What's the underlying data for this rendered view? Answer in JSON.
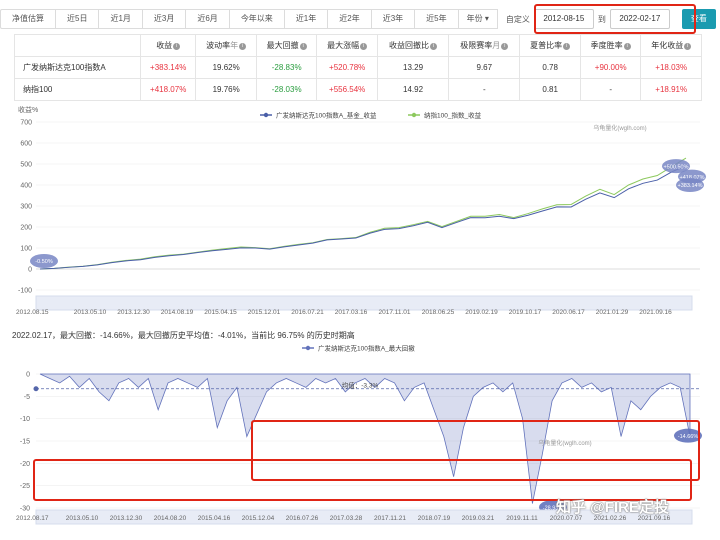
{
  "tabs": [
    "净值估算",
    "近5日",
    "近1月",
    "近3月",
    "近6月",
    "今年以来",
    "近1年",
    "近2年",
    "近3年",
    "近5年"
  ],
  "year_select": "年份",
  "custom_label": "自定义",
  "start_date": "2012-08-15",
  "to_label": "到",
  "end_date": "2022-02-17",
  "query_button": "查看",
  "stats": {
    "headers": [
      "收益",
      "波动率",
      "最大回撤",
      "最大涨幅",
      "收益回撤比",
      "极限赛率",
      "夏普比率",
      "季度胜率",
      "年化收益"
    ],
    "header_units": [
      "",
      "年",
      "",
      "",
      "",
      "月",
      "",
      "",
      ""
    ],
    "header_info": [
      true,
      true,
      true,
      true,
      true,
      true,
      true,
      true,
      true
    ],
    "rows": [
      {
        "name": "广发纳斯达克100指数A",
        "values": [
          "+383.14%",
          "19.62%",
          "-28.83%",
          "+520.78%",
          "13.29",
          "9.67",
          "0.78",
          "+90.00%",
          "+18.03%"
        ],
        "tones": [
          "pos",
          "",
          "neg",
          "pos",
          "",
          "",
          "",
          "pos",
          "pos"
        ]
      },
      {
        "name": "纳指100",
        "values": [
          "+418.07%",
          "19.76%",
          "-28.03%",
          "+556.54%",
          "14.92",
          "-",
          "0.81",
          "-",
          "+18.91%"
        ],
        "tones": [
          "pos",
          "",
          "neg",
          "pos",
          "",
          "",
          "",
          "",
          "pos"
        ]
      }
    ]
  },
  "chart_data": [
    {
      "type": "line",
      "ylabel": "收益%",
      "ylim": [
        -100,
        700
      ],
      "yticks": [
        -100,
        0,
        100,
        200,
        300,
        400,
        500,
        600,
        700
      ],
      "x_start_label": "2012.08.15",
      "xticks": [
        "2013.05.10",
        "2013.12.30",
        "2014.08.19",
        "2015.04.15",
        "2015.12.01",
        "2016.07.21",
        "2017.03.16",
        "2017.11.01",
        "2018.06.25",
        "2019.02.19",
        "2019.10.17",
        "2020.06.17",
        "2021.01.29",
        "2021.09.16"
      ],
      "series": [
        {
          "name": "广发纳斯达克100指数A_基金_收益",
          "color": "#4a5fa8",
          "values": [
            0,
            3,
            8,
            12,
            20,
            30,
            38,
            45,
            55,
            62,
            70,
            78,
            85,
            95,
            100,
            98,
            96,
            105,
            112,
            125,
            138,
            140,
            150,
            170,
            185,
            195,
            205,
            218,
            200,
            220,
            240,
            248,
            250,
            235,
            260,
            275,
            290,
            300,
            330,
            355,
            345,
            380,
            400,
            430,
            460,
            483
          ]
        },
        {
          "name": "纳指100_指数_收益",
          "color": "#8dc95e",
          "values": [
            0,
            3,
            9,
            13,
            21,
            32,
            40,
            48,
            58,
            65,
            72,
            80,
            88,
            99,
            104,
            100,
            98,
            107,
            115,
            127,
            140,
            142,
            152,
            174,
            190,
            200,
            210,
            222,
            205,
            225,
            246,
            255,
            258,
            240,
            268,
            285,
            300,
            312,
            345,
            372,
            360,
            398,
            420,
            452,
            485,
            518
          ]
        }
      ],
      "markers": [
        {
          "label": "-0.50%",
          "color": "#7886c4"
        },
        {
          "label": "+500.50%",
          "color": "#7886c4"
        },
        {
          "label": "+418.07%",
          "color": "#7886c4"
        },
        {
          "label": "+383.14%",
          "color": "#7886c4"
        }
      ],
      "annotation": "乌龟量化(wglh.com)"
    },
    {
      "type": "area",
      "summary": "2022.02.17，最大回撤：-14.66%，最大回撤历史平均值：-4.01%，当前比 96.75% 的历史时期高",
      "legend": "广发纳斯达克100指数A_最大回撤",
      "ylim": [
        -30,
        0
      ],
      "yticks": [
        0,
        -5,
        -10,
        -15,
        -20,
        -25,
        -30
      ],
      "x_start_label": "2012.08.17",
      "xticks": [
        "2013.05.10",
        "2013.12.30",
        "2014.08.20",
        "2015.04.16",
        "2015.12.04",
        "2016.07.26",
        "2017.03.28",
        "2017.11.21",
        "2018.07.19",
        "2019.03.21",
        "2019.11.11",
        "2020.07.07",
        "2021.02.26",
        "2021.09.16"
      ],
      "mean_label": "均值：-3.3%",
      "mean": -3.3,
      "color": "#6272bb",
      "values": [
        0,
        -1,
        -2,
        -0.5,
        -3,
        -1,
        -4,
        -6,
        -2,
        -1,
        -3,
        -1,
        -8,
        -2,
        -1,
        -2,
        -3,
        -1,
        -12,
        -6,
        -3,
        -14,
        -9,
        -4,
        -2,
        -1,
        -2,
        -3,
        -1,
        -2,
        -1,
        -4,
        -2,
        -1,
        -3,
        -1,
        -2,
        -6,
        -3,
        -2,
        -8,
        -14,
        -23,
        -12,
        -5,
        -3,
        -2,
        -4,
        -2,
        -10,
        -29,
        -18,
        -6,
        -2,
        -1,
        -3,
        -2,
        -4,
        -3,
        -14,
        -6,
        -8,
        -5,
        -3,
        -2,
        -3,
        -14
      ],
      "markers": [
        {
          "label": "-28.93%",
          "color": "#6272bb"
        },
        {
          "label": "-14.66%",
          "color": "#6272bb"
        }
      ],
      "annotation": "乌龟量化(wglh.com)"
    }
  ],
  "watermark": "知乎 @FIRE定投"
}
